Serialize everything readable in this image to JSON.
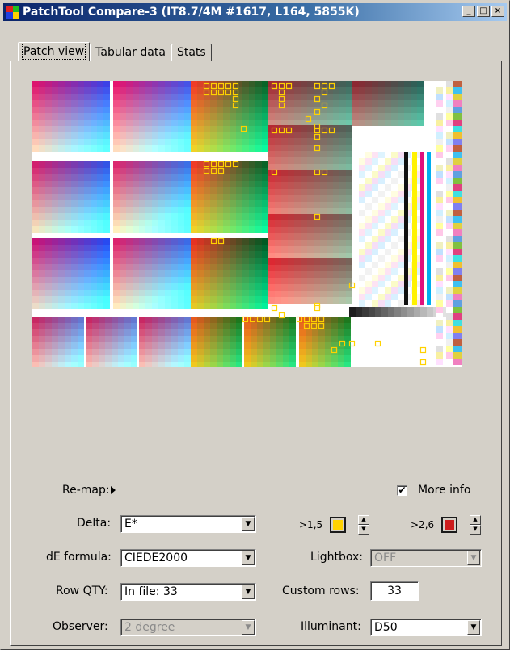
{
  "window": {
    "title": "PatchTool Compare-3 (IT8.7/4M #1617, L164, 5855K)",
    "buttons": {
      "minimize": "_",
      "maximize": "□",
      "close": "×"
    }
  },
  "tabs": [
    {
      "label": "Patch view",
      "active": true
    },
    {
      "label": "Tabular data",
      "active": false
    },
    {
      "label": "Stats",
      "active": false
    }
  ],
  "patch_chart": {
    "description_icon": "patch-grid",
    "highlight_color": "#ffd200"
  },
  "controls": {
    "remap": {
      "label": "Re-map:"
    },
    "more_info": {
      "label": "More info",
      "checked": true,
      "mark": "✔"
    },
    "delta": {
      "label": "Delta:",
      "value": "E*"
    },
    "threshold_low": {
      "label": ">1,5",
      "color": "#ffd200"
    },
    "threshold_high": {
      "label": ">2,6",
      "color": "#cc1c1c"
    },
    "de_formula": {
      "label": "dE formula:",
      "value": "CIEDE2000"
    },
    "lightbox": {
      "label": "Lightbox:",
      "value": "OFF"
    },
    "row_qty": {
      "label": "Row QTY:",
      "value": "In file: 33"
    },
    "custom_rows": {
      "label": "Custom rows:",
      "value": "33"
    },
    "observer": {
      "label": "Observer:",
      "value": "2 degree"
    },
    "illuminant": {
      "label": "Illuminant:",
      "value": "D50"
    }
  }
}
